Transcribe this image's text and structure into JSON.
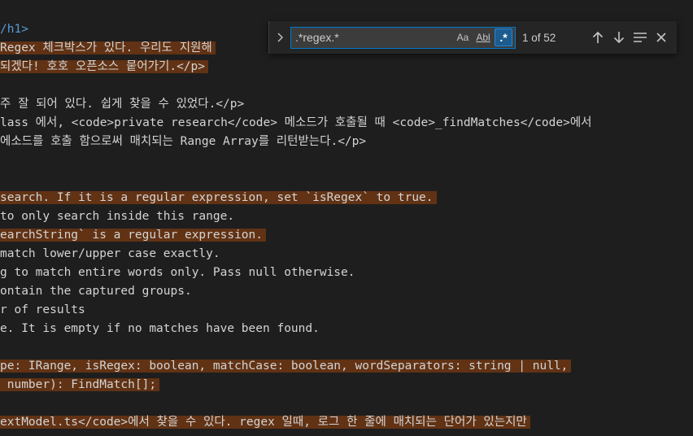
{
  "editor": {
    "lines": [
      {
        "text": "/h1>",
        "hl": false,
        "tag": true
      },
      {
        "text": "Regex 체크박스가 있다. 우리도 지원해",
        "hl": true,
        "tag": false
      },
      {
        "text": "되겠다! 호호 오픈소스 뭍어가기.</p>",
        "hl": true,
        "tag": false
      },
      {
        "text": "",
        "hl": false,
        "tag": false
      },
      {
        "text": "주 잘 되어 있다. 쉽게 찾을 수 있었다.</p>",
        "hl": false,
        "tag": false
      },
      {
        "text": "lass 에서, <code>private research</code> 메소드가 호출될 때 <code>_findMatches</code>에서",
        "hl": false,
        "tag": false
      },
      {
        "text": "에소드를 호출 함으로써 매치되는 Range Array를 리턴받는다.</p>",
        "hl": false,
        "tag": false
      },
      {
        "text": "",
        "hl": false,
        "tag": false
      },
      {
        "text": "",
        "hl": false,
        "tag": false
      },
      {
        "text": "search. If it is a regular expression, set `isRegex` to true.",
        "hl": true,
        "tag": false
      },
      {
        "text": "to only search inside this range.",
        "hl": false,
        "tag": false
      },
      {
        "text": "earchString` is a regular expression.",
        "hl": true,
        "tag": false
      },
      {
        "text": "match lower/upper case exactly.",
        "hl": false,
        "tag": false
      },
      {
        "text": "g to match entire words only. Pass null otherwise.",
        "hl": false,
        "tag": false
      },
      {
        "text": "ontain the captured groups.",
        "hl": false,
        "tag": false
      },
      {
        "text": "r of results",
        "hl": false,
        "tag": false
      },
      {
        "text": "e. It is empty if no matches have been found.",
        "hl": false,
        "tag": false
      },
      {
        "text": "",
        "hl": false,
        "tag": false
      },
      {
        "text": "pe: IRange, isRegex: boolean, matchCase: boolean, wordSeparators: string | null,",
        "hl": true,
        "tag": false
      },
      {
        "text": " number): FindMatch[];",
        "hl": true,
        "tag": false
      },
      {
        "text": "",
        "hl": false,
        "tag": false
      },
      {
        "text": "extModel.ts</code>에서 찾을 수 있다. regex 일때, 로그 한 줄에 매치되는 단어가 있는지만",
        "hl": true,
        "tag": false
      }
    ]
  },
  "find": {
    "query": ".*regex.*",
    "toggle_icon": "chevron-right-icon",
    "match_case_label": "Aa",
    "whole_word_label": "Abl",
    "regex_label": ".*",
    "match_count": "1 of 52",
    "colors": {
      "highlight": "#613214",
      "active_option": "#1c5c8e",
      "focus_border": "#007acc"
    }
  }
}
